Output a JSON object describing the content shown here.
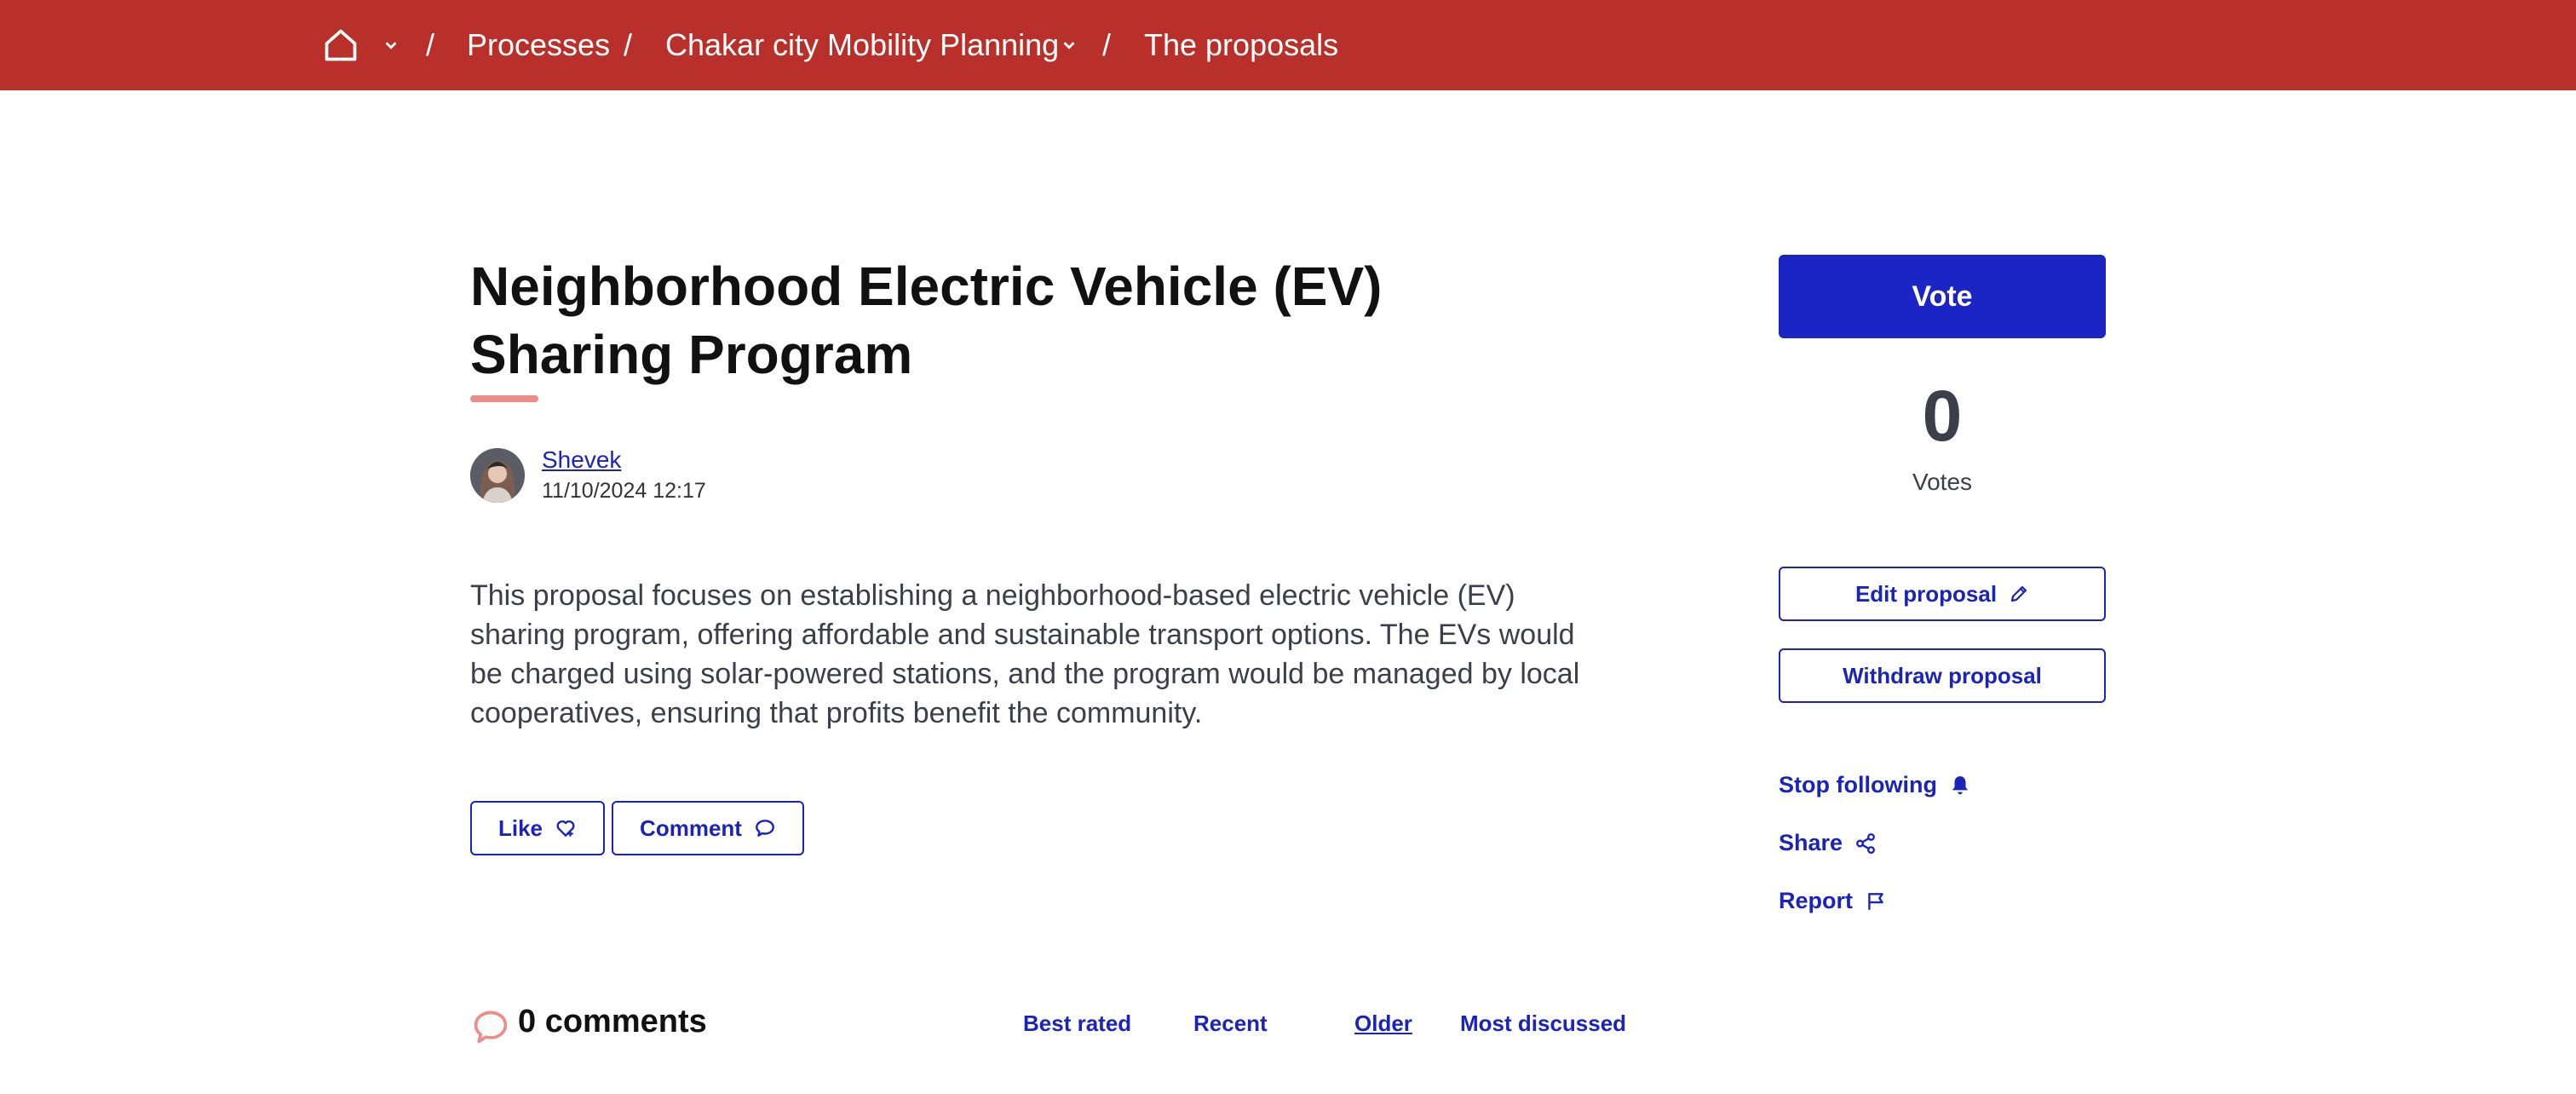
{
  "breadcrumb": {
    "home_icon": "home-icon",
    "home_menu_icon": "chevron-down-icon",
    "separator": "/",
    "processes": "Processes",
    "space": "Chakar city Mobility Planning",
    "current": "The proposals"
  },
  "proposal": {
    "title": "Neighborhood Electric Vehicle (EV) Sharing Program",
    "author": "Shevek",
    "date": "11/10/2024 12:17",
    "body": "This proposal focuses on establishing a neighborhood-based electric vehicle (EV) sharing program, offering affordable and sustainable transport options. The EVs would be charged using solar-powered stations, and the program would be managed by local cooperatives, ensuring that profits benefit the community."
  },
  "actions": {
    "like": "Like",
    "comment": "Comment"
  },
  "comments": {
    "count_label": "0 comments",
    "sort_options": [
      "Best rated",
      "Recent",
      "Older",
      "Most discussed"
    ],
    "active_sort": "Older"
  },
  "sidebar": {
    "vote_label": "Vote",
    "vote_count": "0",
    "votes_label": "Votes",
    "edit_label": "Edit proposal",
    "withdraw_label": "Withdraw proposal",
    "stop_following_label": "Stop following",
    "share_label": "Share",
    "report_label": "Report"
  },
  "colors": {
    "topbar": "#b9302a",
    "primary": "#1b24c4",
    "link": "#1b24b8",
    "accent": "#ee8d87"
  }
}
